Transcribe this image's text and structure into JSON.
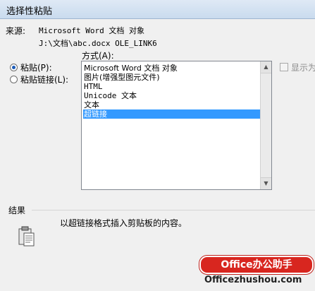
{
  "window": {
    "title": "选择性粘贴"
  },
  "source": {
    "label": "来源:",
    "value": "Microsoft Word 文档 对象",
    "path": "J:\\文档\\abc.docx OLE_LINK6"
  },
  "options": {
    "paste": {
      "label": "粘贴(P):",
      "checked": true
    },
    "paste_link": {
      "label": "粘贴链接(L):",
      "checked": false
    }
  },
  "as": {
    "label": "方式(A):",
    "items": [
      {
        "label": "Microsoft Word 文档 对象",
        "selected": false
      },
      {
        "label": "图片(增强型图元文件)",
        "selected": false
      },
      {
        "label": "HTML",
        "selected": false
      },
      {
        "label": "Unicode 文本",
        "selected": false
      },
      {
        "label": "文本",
        "selected": false
      },
      {
        "label": "超链接",
        "selected": true
      }
    ]
  },
  "display_as_icon": {
    "label": "显示为",
    "checked": false
  },
  "result": {
    "title": "结果",
    "description": "以超链接格式插入剪贴板的内容。"
  },
  "watermark": {
    "badge": "Office办公助手",
    "url": "Officezhushou.com"
  },
  "colors": {
    "selection": "#3399ff",
    "accent": "#d8261f"
  }
}
